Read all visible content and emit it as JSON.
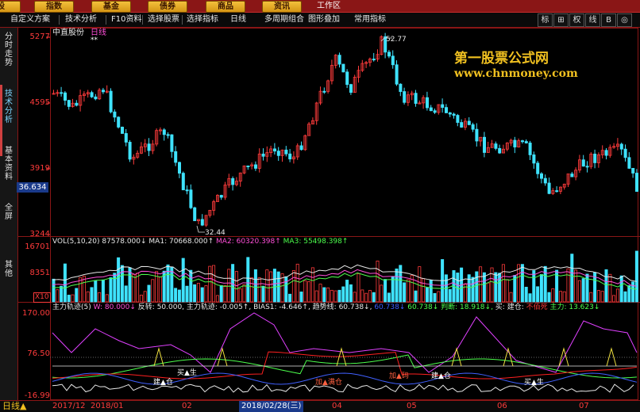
{
  "topnav": {
    "items": [
      "股",
      "指数",
      "基金",
      "债券",
      "商品",
      "资讯"
    ],
    "title": "工作区"
  },
  "toolbar": {
    "items": [
      "自定义方案",
      "技术分析",
      "F10资料",
      "选择股票",
      "选择指标",
      "日线",
      "多周期组合",
      "图形叠加",
      "常用指标"
    ],
    "right_items": [
      "标",
      "⊞",
      "权",
      "线",
      "B",
      "◎"
    ]
  },
  "sidebar": {
    "tabs": [
      "分时走势",
      "技术分析",
      "基本资料",
      "全屏",
      "其他"
    ],
    "active": "技术分析"
  },
  "watermark": {
    "line1": "第一股票公式网",
    "line2": "www.chnmoney.com"
  },
  "stock": {
    "name": "中直股份",
    "period": "日线"
  },
  "main_axis": {
    "ticks": [
      "5277",
      "4595",
      "3919",
      "3244"
    ],
    "current": "36.634"
  },
  "annotations": {
    "high": "52.77",
    "low": "32.44",
    "high_marker": "**"
  },
  "volume_panel": {
    "legend": [
      {
        "text": "VOL(5,10,20)",
        "color": "#e8e8e8"
      },
      {
        "text": "87578.000↓",
        "color": "#e8e8e8"
      },
      {
        "text": "MA1: 70668.000↑",
        "color": "#e8e8e8"
      },
      {
        "text": "MA2: 60320.398↑",
        "color": "#ff4fd8"
      },
      {
        "text": "MA3: 55498.398↑",
        "color": "#4cff4c"
      }
    ],
    "ticks": [
      "16701",
      "8351"
    ],
    "unit": "X10"
  },
  "indicator_panel": {
    "legend": [
      {
        "text": "主力轨迹(5)",
        "color": "#e8e8e8"
      },
      {
        "text": "W: 80.000↓",
        "color": "#ff4fd8"
      },
      {
        "text": "反转: 50.000,",
        "color": "#e8e8e8"
      },
      {
        "text": "主力轨迹: -0.005↑,",
        "color": "#e8e8e8"
      },
      {
        "text": "BIAS1: -4.646↑,",
        "color": "#e8e8e8"
      },
      {
        "text": "趋势线: 60.738↓,",
        "color": "#e8e8e8"
      },
      {
        "text": "60.738↓",
        "color": "#3a5cff"
      },
      {
        "text": "60.738↓",
        "color": "#4cff4c"
      },
      {
        "text": "判断: 18.918↓,",
        "color": "#4cff4c"
      },
      {
        "text": "买: 建仓:",
        "color": "#e8e8e8"
      },
      {
        "text": "不佰死",
        "color": "#ff3b3b"
      },
      {
        "text": "主力: 13.623↓",
        "color": "#4cff4c"
      }
    ],
    "ticks": [
      "170.00",
      "76.50",
      "-16.99"
    ],
    "signals": [
      "买▲生",
      "建▲仓",
      "加▲满仓",
      "加▲码",
      "建▲仓",
      "买▲生"
    ]
  },
  "bottom": {
    "period_label": "日线▲",
    "dates": [
      "2017/12",
      "2018/01",
      "02",
      "2018/02/28(三)",
      "04",
      "05",
      "06",
      "07"
    ]
  },
  "colors": {
    "up": "#ff3b3b",
    "down": "#3fe3ff",
    "accent": "#f0c020",
    "frame": "#8a1616"
  }
}
